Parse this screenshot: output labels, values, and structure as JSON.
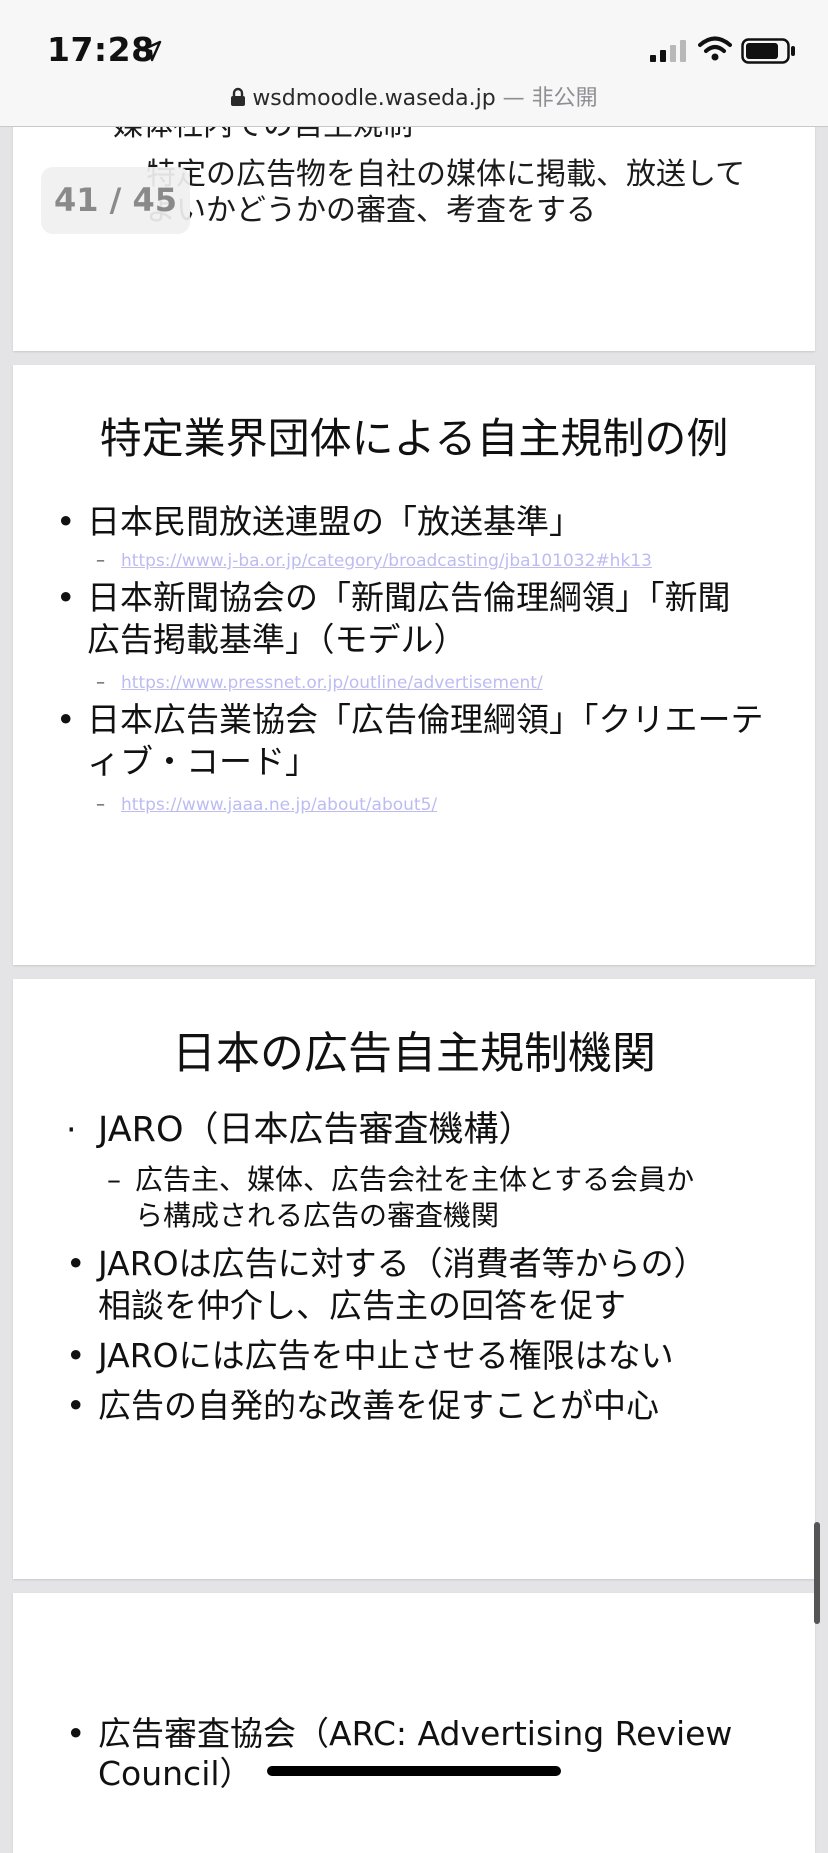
{
  "status_bar": {
    "time": "17:28"
  },
  "url_bar": {
    "domain": "wsdmoodle.waseda.jp",
    "note": " — 非公開"
  },
  "page_counter": "41 / 45",
  "slides": {
    "prev_fragment": {
      "line1": "媒体社内での自主規制",
      "line2": "特定の広告物を自社の媒体に掲載、放送して",
      "line3": "よいかどうかの審査、考査をする"
    },
    "industry": {
      "title": "特定業界団体による自主規制の例",
      "b1": "日本民間放送連盟の「放送基準」",
      "b1_link": "https://www.j-ba.or.jp/category/broadcasting/jba101032#hk13",
      "b2_line1": "日本新聞協会の「新聞広告倫理綱領」「新聞",
      "b2_line2": "広告掲載基準」（モデル）",
      "b2_link": "https://www.pressnet.or.jp/outline/advertisement/",
      "b3_line1": "日本広告業協会「広告倫理綱領」「クリエーテ",
      "b3_line2": "ィブ・コード」",
      "b3_link": "https://www.jaaa.ne.jp/about/about5/"
    },
    "jaro": {
      "title": "日本の広告自主規制機関",
      "b1": "JARO（日本広告審査機構）",
      "b1_sub_line1": "広告主、媒体、広告会社を主体とする会員か",
      "b1_sub_line2": "ら構成される広告の審査機関",
      "b2_line1": "JAROは広告に対する（消費者等からの）",
      "b2_line2": "相談を仲介し、広告主の回答を促す",
      "b3": "JAROには広告を中止させる権限はない",
      "b4": "広告の自発的な改善を促すことが中心"
    },
    "arc": {
      "b1_line1": "広告審査協会（ARC: Advertising Review",
      "b1_line2": "Council）"
    }
  }
}
